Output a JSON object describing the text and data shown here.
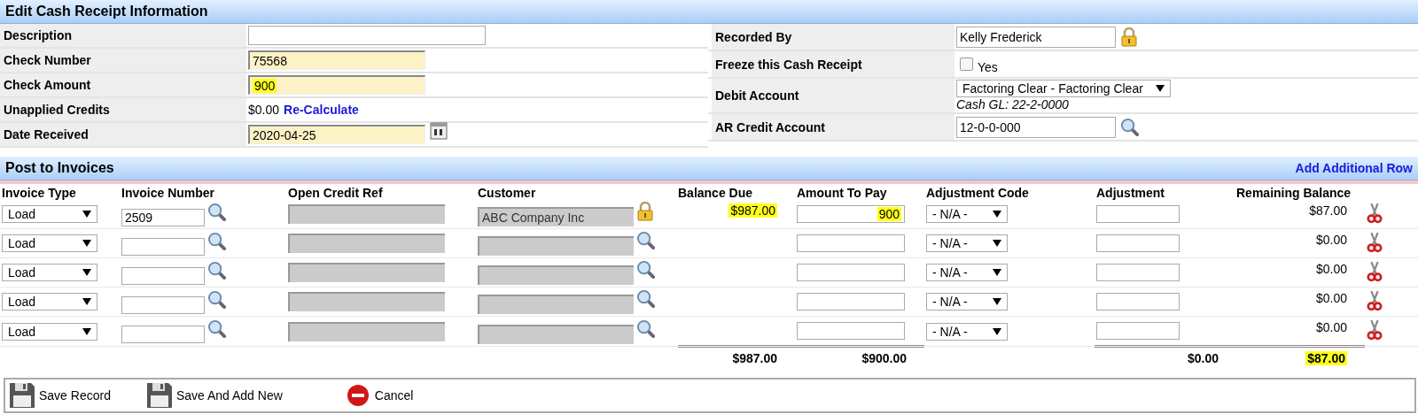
{
  "receipt": {
    "title": "Edit Cash Receipt Information",
    "left_fields": [
      {
        "label": "Description",
        "kind": "input",
        "required": false
      },
      {
        "label": "Check Number",
        "kind": "input",
        "value": "75568",
        "required": true,
        "marked": false
      },
      {
        "label": "Check Amount",
        "kind": "input",
        "value": "900",
        "required": true,
        "marked": true
      },
      {
        "label": "Unapplied Credits",
        "kind": "text",
        "value": "$0.00",
        "link": "Re-Calculate"
      },
      {
        "label": "Date Received",
        "kind": "date",
        "value": "2020-04-25",
        "required": true,
        "marked": false
      }
    ],
    "right_fields": [
      {
        "label": "Recorded By",
        "kind": "locked",
        "value": "Kelly Frederick"
      },
      {
        "label": "Freeze this Cash Receipt",
        "kind": "checkbox",
        "option": "Yes",
        "checked": false
      },
      {
        "label": "Debit Account",
        "kind": "select",
        "value": "Factoring Clear - Factoring Clear",
        "note": "Cash GL: 22-2-0000"
      },
      {
        "label": "AR Credit Account",
        "kind": "lookup",
        "value": "12-0-0-000"
      }
    ]
  },
  "invoices": {
    "title": "Post to Invoices",
    "link": "Add Additional Row",
    "columns": [
      "Invoice Type",
      "Invoice Number",
      "Open Credit Ref",
      "Customer",
      "Balance Due",
      "Amount To Pay",
      "Adjustment Code",
      "Adjustment",
      "Remaining Balance"
    ],
    "rows": [
      {
        "invoice_type": "Load",
        "invoice_number": "2509",
        "customer": "ABC Company Inc",
        "customer_locked": true,
        "balance_due": "$987.00",
        "balance_marked": true,
        "amount_to_pay": "900",
        "amount_marked": true,
        "adjustment_code": "- N/A -",
        "remaining_balance": "$87.00"
      },
      {
        "invoice_type": "Load",
        "customer_locked": false,
        "adjustment_code": "- N/A -",
        "remaining_balance": "$0.00"
      },
      {
        "invoice_type": "Load",
        "customer_locked": false,
        "adjustment_code": "- N/A -",
        "remaining_balance": "$0.00"
      },
      {
        "invoice_type": "Load",
        "customer_locked": false,
        "adjustment_code": "- N/A -",
        "remaining_balance": "$0.00"
      },
      {
        "invoice_type": "Load",
        "customer_locked": false,
        "adjustment_code": "- N/A -",
        "remaining_balance": "$0.00"
      }
    ],
    "totals": {
      "balance_due": "$987.00",
      "amount_to_pay": "$900.00",
      "adjustment": "$0.00",
      "remaining_balance": "$87.00",
      "remaining_marked": true
    }
  },
  "toolbar": [
    {
      "label": "Save Record",
      "kind": "save"
    },
    {
      "label": "Save And Add New",
      "kind": "save"
    },
    {
      "label": "Cancel",
      "kind": "cancel"
    }
  ]
}
